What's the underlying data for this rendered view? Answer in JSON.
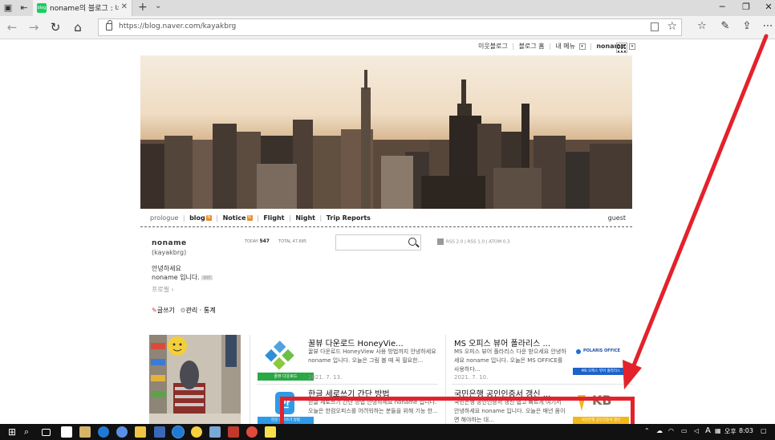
{
  "browser": {
    "tab_title": "noname의 블로그 : 네이",
    "url": "https://blog.naver.com/kayakbrg",
    "favicon_label": "blog"
  },
  "topnav": {
    "neighbor_blog": "이웃블로그",
    "blog_home": "블로그 홈",
    "my_menu": "내 메뉴",
    "user": "noname"
  },
  "menu": {
    "prologue": "prologue",
    "blog": "blog",
    "notice": "Notice",
    "flight": "Flight",
    "night": "Night",
    "trip": "Trip Reports",
    "guest": "guest"
  },
  "profile": {
    "name": "noname",
    "id": "(kayakbrg)",
    "greet1": "안녕하세요",
    "greet2": "noname 입니다.",
    "edit": "EDIT",
    "profile_link": "프로필",
    "write": "글쓰기",
    "admin": "관리 · 통계"
  },
  "stats": {
    "today_label": "TODAY",
    "today": "547",
    "total_label": "TOTAL",
    "total": "47,685"
  },
  "rss": "RSS 2.0  |  RSS 1.0  |  ATOM 0.3",
  "posts": [
    {
      "title": "꿀뷰 다운로드 HoneyVie...",
      "body": "꿀뷰 다운로드 HoneyView 사용 방법까지 안녕하세요 noname 입니다. 오늘은 그림 볼 때 꼭 필요한...",
      "date": "2021. 7. 13.",
      "thumb_caption": "꿀뷰 다운로드"
    },
    {
      "title": "MS 오피스 뷰어 폴라리스 ...",
      "body": "MS 오피스 뷰어 폴라리스 다운 받으세요 안녕하세요 noname 입니다. 오늘은 MS OFFICE를 사용하다...",
      "date": "2021. 7. 10.",
      "thumb_brand": "POLARIS OFFICE",
      "thumb_caption": "MS 오피스 뷰어 폴라리스"
    },
    {
      "title": "한글 세로쓰기 간단 방법",
      "body": "한글 세로쓰기 간단 방법 안녕하세요 noname 입니다. 오늘은 한컴오피스를 어려워하는 분들을 위해 기능 한...",
      "thumb_caption": "한글 세로쓰기 방법"
    },
    {
      "title": "국민은행 공인인증서 갱신 ...",
      "body": "국민은행 공인인증서 갱신 쉽고 빠르게 여기서 안녕하세요 noname 입니다. 오늘은 매년 몸이면 해야하는 대...",
      "thumb_brand": "KB",
      "thumb_caption": "국민은행 공인인증서 갱신"
    }
  ],
  "taskbar": {
    "ampm": "오후",
    "time": "8:03",
    "ime": "A"
  },
  "colors": {
    "annotation_red": "#e3222b",
    "naver_green": "#19ce60",
    "new_badge": "#f08a26"
  }
}
